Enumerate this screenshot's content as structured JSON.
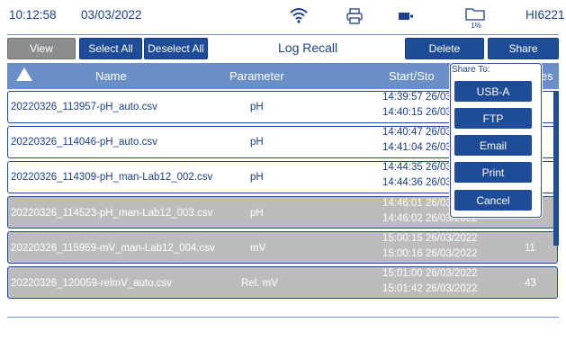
{
  "status": {
    "time": "10:12:58",
    "date": "03/03/2022",
    "storage": "1%",
    "device": "HI6221"
  },
  "toolbar": {
    "view": "View",
    "select_all": "Select All",
    "deselect_all": "Deselect All",
    "title": "Log Recall",
    "delete": "Delete",
    "share": "Share"
  },
  "columns": {
    "name": "Name",
    "parameter": "Parameter",
    "start_stop": "Start/Sto",
    "samples": "les"
  },
  "rows": [
    {
      "name": "20220326_113957-pH_auto.csv",
      "param": "pH",
      "start": "14:39:57 26/03",
      "stop": "14:40:15 26/03",
      "samples": ""
    },
    {
      "name": "20220326_114046-pH_auto.csv",
      "param": "pH",
      "start": "14:40:47 26/03",
      "stop": "14:41:04 26/03",
      "samples": ""
    },
    {
      "name": "20220326_114309-pH_man-Lab12_002.csv",
      "param": "pH",
      "start": "14:44:35 26/03",
      "stop": "14:44:36 26/03",
      "samples": ""
    },
    {
      "name": "20220326_114523-pH_man-Lab12_003.csv",
      "param": "pH",
      "start": "14:46:01 26/03",
      "stop": "14:46:02 26/03/2022",
      "samples": ""
    },
    {
      "name": "20220326_115959-mV_man-Lab12_004.csv",
      "param": "mV",
      "start": "15:00:15 26/03/2022",
      "stop": "15:00:16 26/03/2022",
      "samples": "11"
    },
    {
      "name": "20220326_120059-relmV_auto.csv",
      "param": "Rel. mV",
      "start": "15:01:00 26/03/2022",
      "stop": "15:01:42 26/03/2022",
      "samples": "43"
    }
  ],
  "share_popup": {
    "title": "Share To:",
    "usb": "USB-A",
    "ftp": "FTP",
    "email": "Email",
    "print": "Print",
    "cancel": "Cancel"
  },
  "colors": {
    "accent": "#1f4c99",
    "header": "#6a8fc7",
    "selected_row": "#bcbcbc"
  },
  "icons": [
    "wifi-icon",
    "printer-icon",
    "battery-icon",
    "folder-icon",
    "sort-up-icon"
  ]
}
